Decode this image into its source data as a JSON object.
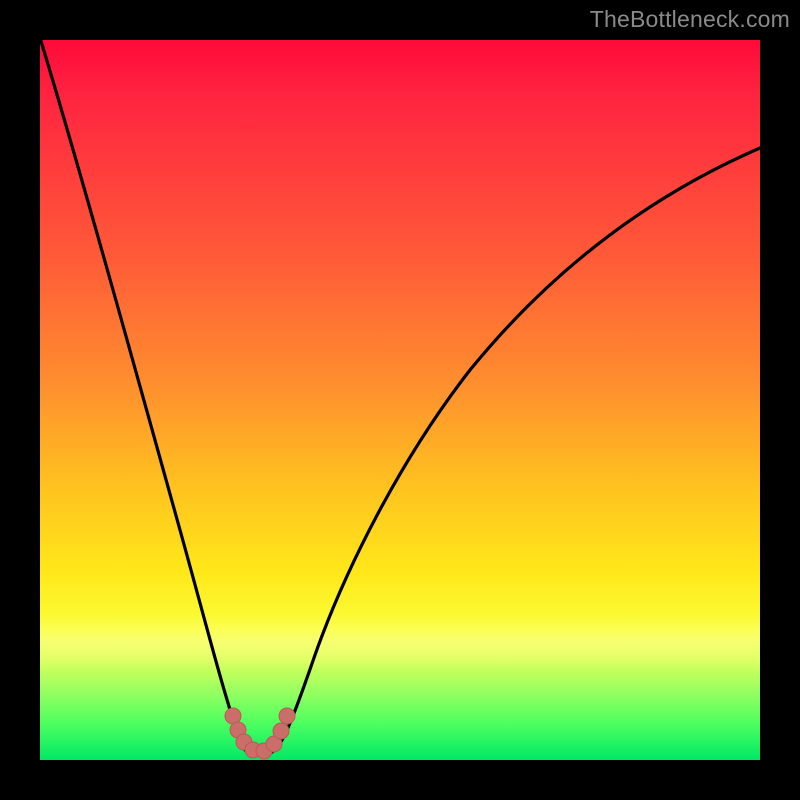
{
  "watermark": "TheBottleneck.com",
  "colors": {
    "curve_stroke": "#000000",
    "marker_fill": "#cb6e6a",
    "marker_stroke": "#b85a56",
    "background": "#000000"
  },
  "chart_data": {
    "type": "line",
    "title": "",
    "xlabel": "",
    "ylabel": "",
    "xlim": [
      0,
      100
    ],
    "ylim": [
      0,
      100
    ],
    "grid": false,
    "legend": false,
    "note": "No axis ticks or labels are rendered; values are read off pixel positions and normalized to 0–100. y = 0 is bottom (green, optimal), y = 100 is top (red, severe bottleneck). Curve reaches a minimum near x ≈ 30 where it touches y ≈ 0.",
    "series": [
      {
        "name": "bottleneck-curve",
        "x": [
          0,
          5,
          10,
          15,
          20,
          24,
          26,
          28,
          30,
          32,
          34,
          38,
          45,
          55,
          65,
          75,
          85,
          95,
          100
        ],
        "values": [
          100,
          84,
          67,
          49,
          30,
          13,
          6,
          2,
          0,
          2,
          8,
          20,
          35,
          50,
          59,
          66,
          71,
          74,
          75
        ]
      }
    ],
    "markers": {
      "name": "near-optimal-region",
      "x": [
        26,
        28,
        30,
        32,
        34
      ],
      "values": [
        5.5,
        1.8,
        0.5,
        1.8,
        5.5
      ]
    }
  }
}
